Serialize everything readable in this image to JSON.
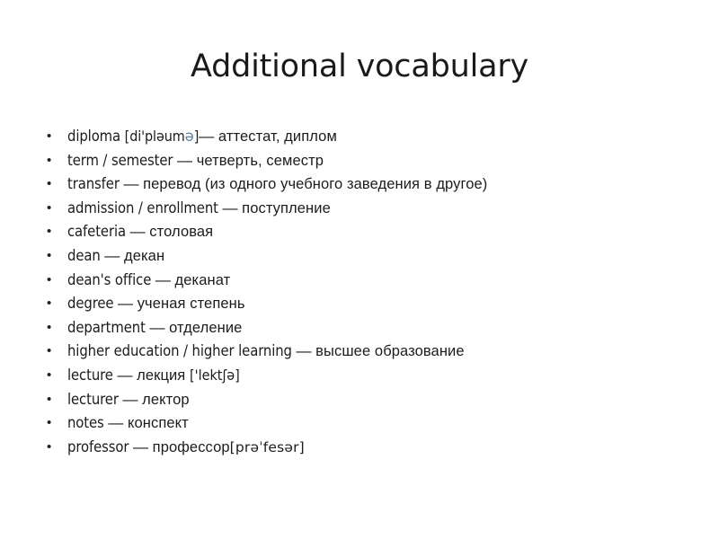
{
  "slide": {
    "title": "Additional vocabulary",
    "background_color": "#ffffff",
    "text_color": "#1c1c1c",
    "bullet_glyph": "•",
    "accent_schwa_color": "#5b84a6"
  },
  "items": [
    {
      "term": "diploma",
      "transcription_open": "[di'pl",
      "transcription_mid": "əum",
      "transcription_schwa": "ə",
      "transcription_close": "]",
      "dash": "—",
      "translation": " аттестат, диплом",
      "full_text": "diploma [di'pləumə]— аттестат, диплом"
    },
    {
      "term": "term / semester ",
      "dash": "—",
      "translation": " четверть, семестр",
      "full_text": "term / semester — четверть, семестр"
    },
    {
      "term": "transfer ",
      "dash": "—",
      "translation": " перевод (из одного учебного заведения в другое)",
      "full_text": "transfer — перевод (из одного учебного заведения в другое)"
    },
    {
      "term": "admission / enrollment ",
      "dash": "—",
      "translation": " поступление",
      "full_text": "admission / enrollment — поступление"
    },
    {
      "term": "cafeteria ",
      "dash": "—",
      "translation": " столовая",
      "full_text": "cafeteria — столовая"
    },
    {
      "term": "dean ",
      "dash": "—",
      "translation": " декан",
      "full_text": "dean — декан"
    },
    {
      "term": "dean's office ",
      "dash": "—",
      "translation": " деканат",
      "full_text": "dean's office — деканат"
    },
    {
      "term": "degree ",
      "dash": "—",
      "translation": " ученая степень",
      "full_text": "degree — ученая степень"
    },
    {
      "term": "department ",
      "dash": "—",
      "translation": " отделение",
      "full_text": "department — отделение"
    },
    {
      "term": "higher education / higher learning ",
      "dash": "—",
      "translation": " высшее образование",
      "full_text": "higher education / higher learning — высшее образование"
    },
    {
      "term": "lecture ",
      "dash": "—",
      "translation": " лекция ",
      "transcription": "['lektʃə]",
      "full_text": "lecture — лекция ['lektʃə]"
    },
    {
      "term": "lecturer ",
      "dash": "—",
      "translation": " лектор",
      "full_text": "lecturer — лектор"
    },
    {
      "term": "notes ",
      "dash": "—",
      "translation": " конспект",
      "full_text": "notes — конспект"
    },
    {
      "term": "professor ",
      "dash": "—",
      "translation": " профессор",
      "transcription": "[prəˈfesər]",
      "full_text": "professor — профессор[prəˈfesər]"
    }
  ]
}
